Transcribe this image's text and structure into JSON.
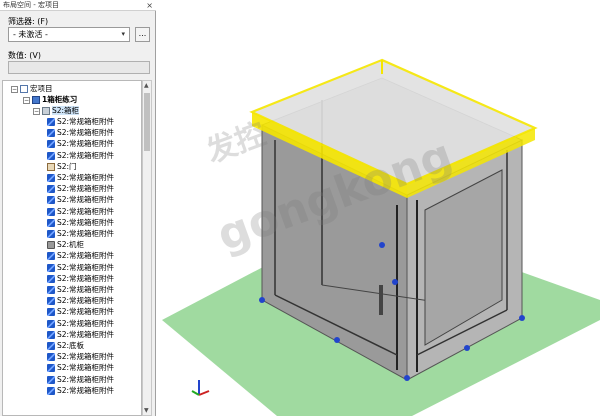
{
  "panel": {
    "title": "布局空间 - 宏项目",
    "close_glyph": "×",
    "filter_label": "筛选器: (F)",
    "filter_value": "- 未激活 -",
    "more_button": "...",
    "value_label": "数值: (V)",
    "value_input": ""
  },
  "tree": {
    "root": "宏项目",
    "project": "1箱柜练习",
    "box": "S2:箱柜",
    "items": [
      "S2:常规箱柜附件",
      "S2:常规箱柜附件",
      "S2:常规箱柜附件",
      "S2:常规箱柜附件",
      "S2:门",
      "S2:常规箱柜附件",
      "S2:常规箱柜附件",
      "S2:常规箱柜附件",
      "S2:常规箱柜附件",
      "S2:常规箱柜附件",
      "S2:常规箱柜附件",
      "S2:机柜",
      "S2:常规箱柜附件",
      "S2:常规箱柜附件",
      "S2:常规箱柜附件",
      "S2:常规箱柜附件",
      "S2:常规箱柜附件",
      "S2:常规箱柜附件",
      "S2:常规箱柜附件",
      "S2:常规箱柜附件",
      "S2:底板",
      "S2:常规箱柜附件",
      "S2:常规箱柜附件",
      "S2:常规箱柜附件",
      "S2:常规箱柜附件"
    ],
    "item_icons": [
      "part-icon",
      "part-icon",
      "part-icon",
      "part-icon",
      "door-icon",
      "part-icon",
      "part-icon",
      "part-icon",
      "part-icon",
      "part-icon",
      "part-icon",
      "cabinet-icon",
      "part-icon",
      "part-icon",
      "part-icon",
      "part-icon",
      "part-icon",
      "part-icon",
      "part-icon",
      "part-icon",
      "part-icon",
      "part-icon",
      "part-icon",
      "part-icon",
      "part-icon"
    ]
  },
  "viewport": {
    "watermark_top": "发控",
    "watermark_main": "gongkong",
    "highlight_color": "#f5e600",
    "floor_color": "#8fd48f"
  }
}
